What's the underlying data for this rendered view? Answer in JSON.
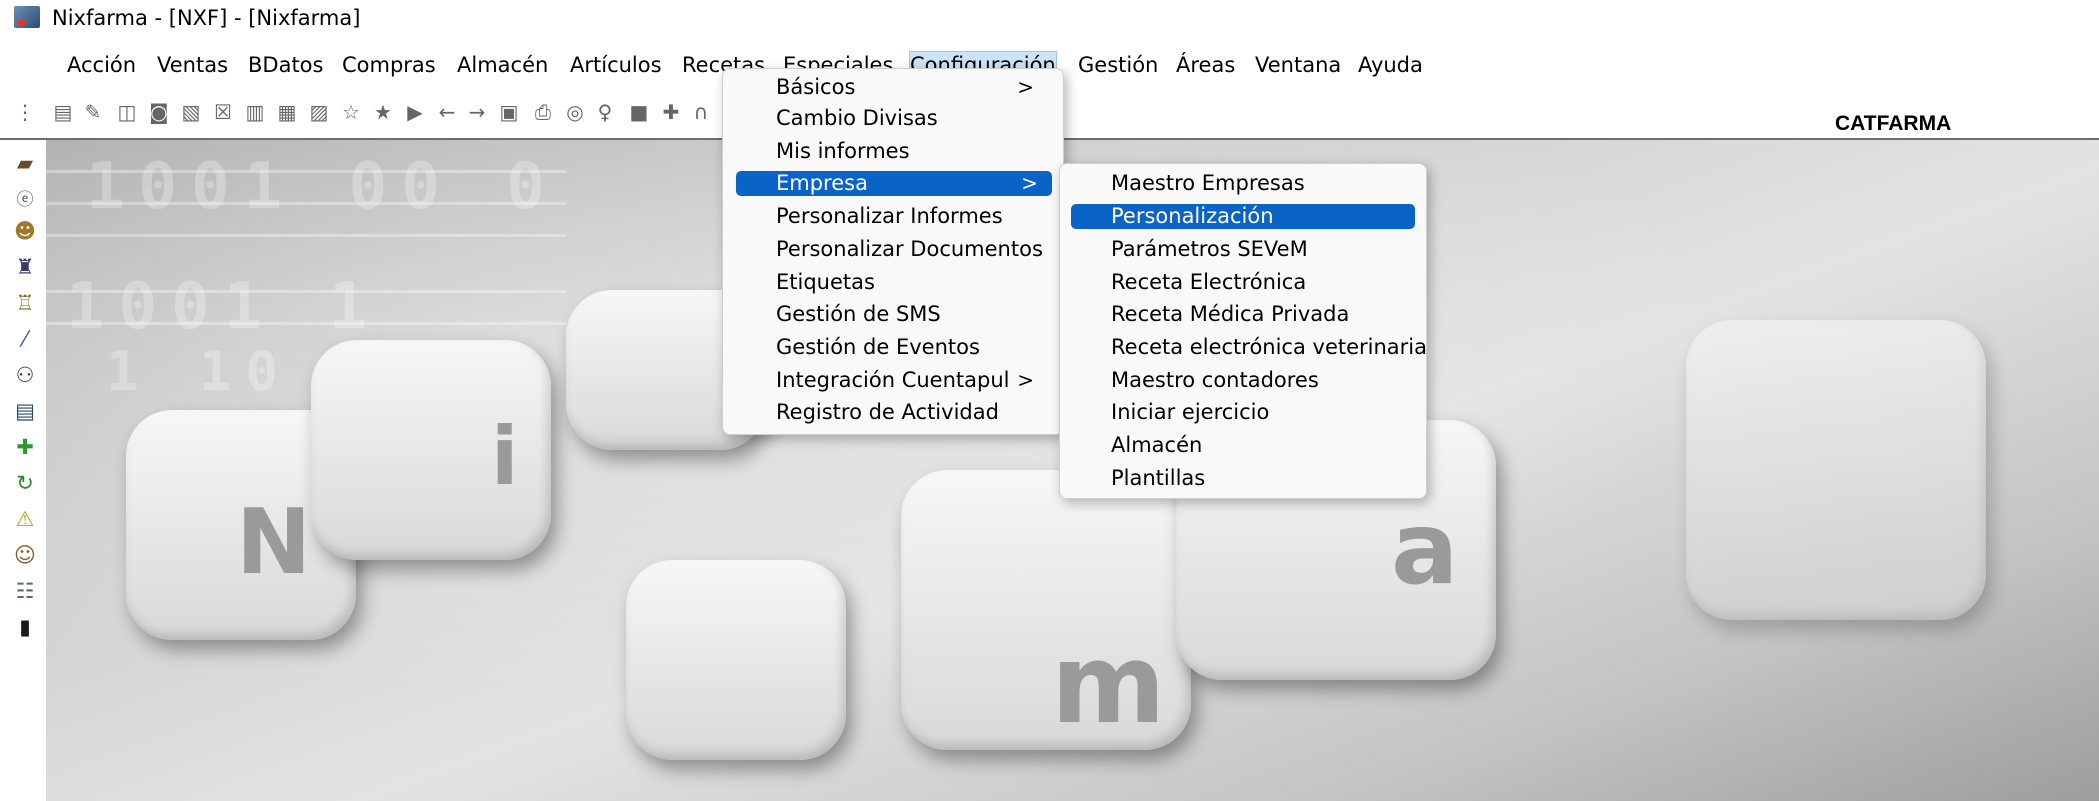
{
  "window": {
    "title": "Nixfarma - [NXF] - [Nixfarma]"
  },
  "menubar": {
    "items": [
      {
        "label": "Acción"
      },
      {
        "label": "Ventas"
      },
      {
        "label": "BDatos"
      },
      {
        "label": "Compras"
      },
      {
        "label": "Almacén"
      },
      {
        "label": "Artículos"
      },
      {
        "label": "Recetas"
      },
      {
        "label": "Especiales"
      },
      {
        "label": "Configuración"
      },
      {
        "label": "Gestión"
      },
      {
        "label": "Áreas"
      },
      {
        "label": "Ventana"
      },
      {
        "label": "Ayuda"
      }
    ]
  },
  "toolbar": {
    "icons": [
      "grip-icon",
      "list-icon",
      "edit-icon",
      "cube-icon",
      "binoculars-icon",
      "note-icon",
      "checkbox-icon",
      "report-icon",
      "document-icon",
      "layout-icon",
      "star-outline-icon",
      "star-icon",
      "import-icon",
      "arrow-left-icon",
      "arrow-right-icon",
      "export-icon",
      "printer-icon",
      "search-icon",
      "location-icon",
      "book-icon",
      "add-user-icon",
      "headset-icon"
    ]
  },
  "leftbar": {
    "icons": [
      "cash-register-icon",
      "e-prescription-icon",
      "user-search-icon",
      "cart-icon",
      "factory-icon",
      "pill-icon",
      "people-icon",
      "printer-icon",
      "green-cross-icon",
      "refresh-icon",
      "warning-icon",
      "users-icon",
      "team-icon",
      "barcode-icon"
    ]
  },
  "desktop": {
    "corner_label": "CATFARMA",
    "key_letters": [
      "N",
      "i",
      "m",
      "a"
    ],
    "bg_digits": [
      "1001 00 0",
      "1001 1",
      "1 10 100"
    ]
  },
  "config_menu": {
    "items": [
      {
        "label": "Básicos",
        "submenu": true
      },
      {
        "label": "Cambio Divisas"
      },
      {
        "label": "Mis informes"
      },
      {
        "label": "Empresa",
        "submenu": true,
        "highlighted": true
      },
      {
        "label": "Personalizar Informes"
      },
      {
        "label": "Personalizar Documentos"
      },
      {
        "label": "Etiquetas"
      },
      {
        "label": "Gestión de SMS"
      },
      {
        "label": "Gestión de Eventos"
      },
      {
        "label": "Integración Cuentapul",
        "submenu": true
      },
      {
        "label": "Registro de Actividad"
      }
    ],
    "arrow_glyph": ">"
  },
  "empresa_submenu": {
    "items": [
      {
        "label": "Maestro Empresas"
      },
      {
        "label": "Personalización",
        "highlighted": true
      },
      {
        "label": "Parámetros SEVeM"
      },
      {
        "label": "Receta Electrónica"
      },
      {
        "label": "Receta Médica Privada"
      },
      {
        "label": "Receta electrónica veterinaria"
      },
      {
        "label": "Maestro contadores"
      },
      {
        "label": "Iniciar ejercicio"
      },
      {
        "label": "Almacén"
      },
      {
        "label": "Plantillas"
      }
    ]
  },
  "colors": {
    "highlight": "#0a64c8",
    "menu_bg": "#f9f9f9",
    "active_menubar": "#cce4f7"
  }
}
